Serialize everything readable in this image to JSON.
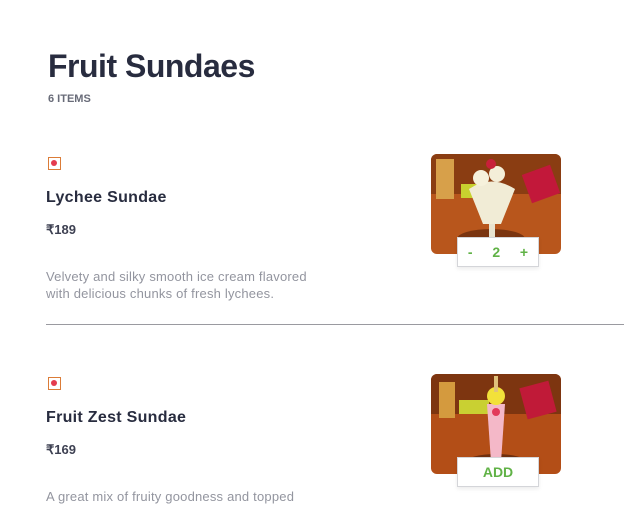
{
  "section": {
    "title": "Fruit Sundaes",
    "count": "6 ITEMS"
  },
  "items": [
    {
      "name": "Lychee Sundae",
      "price": "₹189",
      "desc_line1": "Velvety and silky smooth ice cream flavored",
      "desc_line2": "with delicious chunks of fresh lychees.",
      "qty": "2",
      "minus": "-",
      "plus": "+"
    },
    {
      "name": "Fruit Zest Sundae",
      "price": "₹169",
      "desc_line1": "A great mix of fruity goodness and topped",
      "add_label": "ADD"
    }
  ],
  "colors": {
    "accent": "#60b246",
    "veg_border": "#db7c38",
    "veg_dot": "#e43b4f"
  }
}
